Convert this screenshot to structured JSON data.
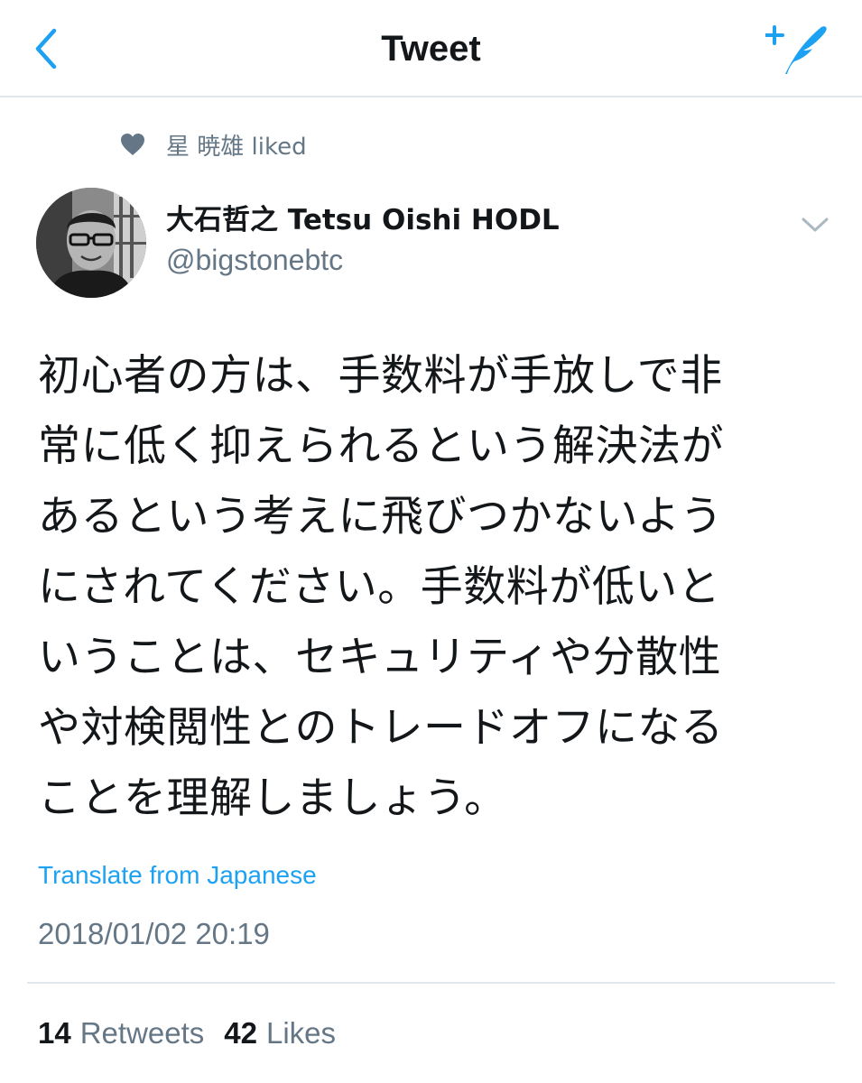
{
  "nav": {
    "title": "Tweet",
    "back_icon": "chevron-left-icon",
    "compose_icon": "compose-tweet-icon",
    "accent_color": "#1da1f2"
  },
  "social_context": {
    "icon": "heart-icon",
    "text": "星 暁雄 liked"
  },
  "author": {
    "name": "大石哲之 Tetsu Oishi HODL",
    "handle": "@bigstonebtc"
  },
  "tweet": {
    "lines": [
      "初心者の方は、手数料が手放しで非",
      "常に低く抑えられるという解決法が",
      "あるという考えに飛びつかないよう",
      "にされてください。手数料が低いと",
      "いうことは、セキュリティや分散性",
      "や対検閲性とのトレードオフになる",
      "ことを理解しましょう。"
    ],
    "translate_label": "Translate from Japanese",
    "timestamp": "2018/01/02 20:19"
  },
  "stats": {
    "retweets_count": "14",
    "retweets_label": "Retweets",
    "likes_count": "42",
    "likes_label": "Likes"
  }
}
